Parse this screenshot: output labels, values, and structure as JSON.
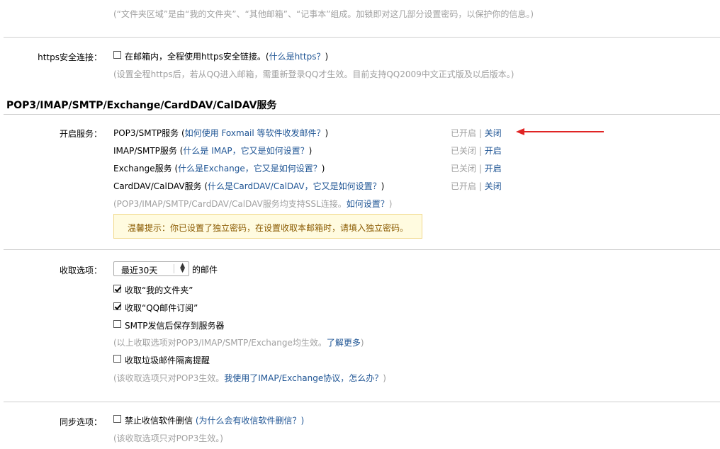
{
  "folder_note": "(“文件夹区域”是由“我的文件夹”、“其他邮箱”、“记事本”组成。加锁即对这几部分设置密码，以保护你的信息。)",
  "https": {
    "label": "https安全连接：",
    "checkbox_text": "在邮箱内，全程使用https安全链接。(",
    "link": "什么是https？",
    "close_paren": ")",
    "checked": false,
    "note": "(设置全程https后，若从QQ进入邮箱，需重新登录QQ才生效。目前支持QQ2009中文正式版及以后版本。)"
  },
  "section_title": "POP3/IMAP/SMTP/Exchange/CardDAV/CalDAV服务",
  "services": {
    "label": "开启服务：",
    "items": [
      {
        "name": "POP3/SMTP服务 (",
        "link": "如何使用 Foxmail 等软件收发邮件？",
        "tail": ")",
        "status": "已开启",
        "sep": "|",
        "action": "关闭"
      },
      {
        "name": "IMAP/SMTP服务 (",
        "link": "什么是 IMAP，它又是如何设置？",
        "tail": ")",
        "status": "已关闭",
        "sep": "|",
        "action": "开启"
      },
      {
        "name": "Exchange服务 (",
        "link": "什么是Exchange，它又是如何设置？",
        "tail": ")",
        "status": "已关闭",
        "sep": "|",
        "action": "开启"
      },
      {
        "name": "CardDAV/CalDAV服务 (",
        "link": "什么是CardDAV/CalDAV，它又是如何设置？",
        "tail": ")",
        "status": "已开启",
        "sep": "|",
        "action": "关闭"
      }
    ],
    "ssl_note": "(POP3/IMAP/SMTP/CardDAV/CalDAV服务均支持SSL连接。",
    "ssl_link": "如何设置？",
    "ssl_tail": ")",
    "tip": "温馨提示：你已设置了独立密码，在设置收取本邮箱时，请填入独立密码。"
  },
  "receive": {
    "label": "收取选项：",
    "select_value": "最近30天",
    "select_suffix": "的邮件",
    "options": [
      {
        "text": "收取“我的文件夹”",
        "checked": true
      },
      {
        "text": "收取“QQ邮件订阅”",
        "checked": true
      },
      {
        "text": "SMTP发信后保存到服务器",
        "checked": false
      }
    ],
    "note1": "(以上收取选项对POP3/IMAP/SMTP/Exchange均生效。",
    "note1_link": "了解更多",
    "note1_tail": ")",
    "spam_option": {
      "text": "收取垃圾邮件隔离提醒",
      "checked": false
    },
    "note2": "(该收取选项只对POP3生效。",
    "note2_link": "我使用了IMAP/Exchange协议，怎么办？",
    "note2_tail": ")"
  },
  "sync": {
    "label": "同步选项：",
    "option": {
      "text": "禁止收信软件删信",
      "checked": false
    },
    "link": "(为什么会有收信软件删信？)",
    "note": "(该收取选项只对POP3生效。)"
  }
}
